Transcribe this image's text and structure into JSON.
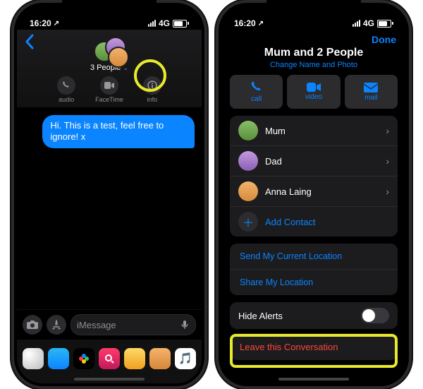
{
  "status": {
    "time": "16:20",
    "locsvc": "↗",
    "network": "4G"
  },
  "phone1": {
    "back_icon": "chevron-left",
    "group_title": "3 People",
    "actions": {
      "audio": "audio",
      "facetime": "FaceTime",
      "info": "info"
    },
    "message": "Hi. This is a test, feel free to ignore! x",
    "compose_placeholder": "iMessage"
  },
  "phone2": {
    "done": "Done",
    "title": "Mum and 2 People",
    "subtitle": "Change Name and Photo",
    "trio": {
      "call": "call",
      "video": "video",
      "mail": "mail"
    },
    "contacts": [
      {
        "name": "Mum",
        "color1": "#8abf69",
        "color2": "#5a8f3b"
      },
      {
        "name": "Dad",
        "color1": "#c59adf",
        "color2": "#8a5eb4"
      },
      {
        "name": "Anna Laing",
        "color1": "#f3b26d",
        "color2": "#d78a3c"
      }
    ],
    "add_contact": "Add Contact",
    "send_location": "Send My Current Location",
    "share_location": "Share My Location",
    "hide_alerts": "Hide Alerts",
    "leave": "Leave this Conversation"
  }
}
